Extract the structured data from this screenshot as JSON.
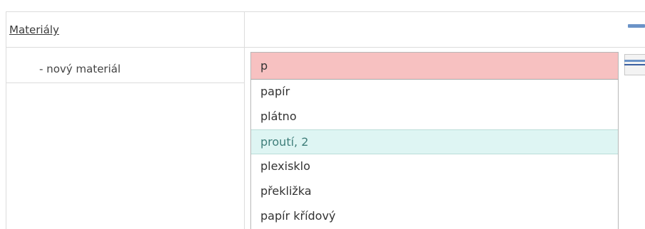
{
  "section": {
    "title": "Materiály",
    "collapse_icon": "minus-icon"
  },
  "field": {
    "label": "- nový materiál",
    "value": "p",
    "list_icon": "list-icon"
  },
  "dropdown": {
    "options": [
      "papír",
      "plátno",
      "proutí, 2",
      "plexisklo",
      "překližka",
      "papír křídový"
    ],
    "active_index": 2
  },
  "colors": {
    "input_error_bg": "#f7c1c1",
    "active_option_bg": "#def5f3",
    "icon_blue": "#6b93c7"
  }
}
